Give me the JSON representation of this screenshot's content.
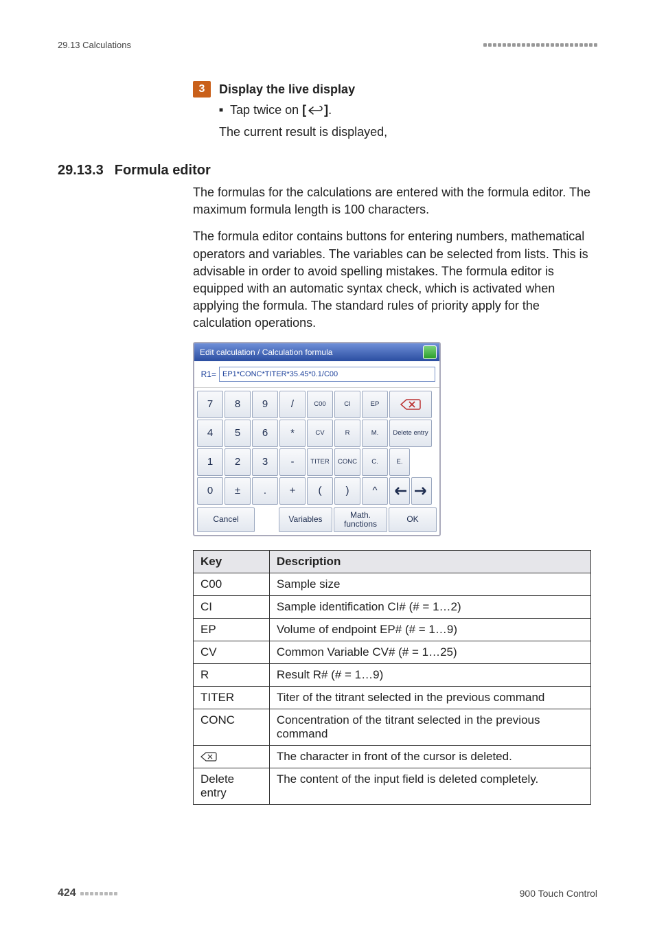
{
  "header": {
    "section_label": "29.13 Calculations"
  },
  "step": {
    "number": "3",
    "title": "Display the live display",
    "bullet": "Tap twice on ",
    "bracket_open": "[",
    "bracket_close": "]",
    "after_icon": ".",
    "result_line": "The current result is displayed,"
  },
  "section": {
    "number": "29.13.3",
    "title": "Formula editor",
    "para1": "The formulas for the calculations are entered with the formula editor. The maximum formula length is 100 characters.",
    "para2": "The formula editor contains buttons for entering numbers, mathematical operators and variables. The variables can be selected from lists. This is advisable in order to avoid spelling mistakes. The formula editor is equipped with an automatic syntax check, which is activated when applying the formula. The standard rules of priority apply for the calculation operations."
  },
  "editor": {
    "titlebar": "Edit calculation / Calculation formula",
    "r1_label": "R1=",
    "formula_value": "EP1*CONC*TITER*35.45*0.1/C00",
    "keys": {
      "k7": "7",
      "k8": "8",
      "k9": "9",
      "div": "/",
      "c00": "C00",
      "ci": "CI",
      "ep": "EP",
      "k4": "4",
      "k5": "5",
      "k6": "6",
      "mul": "*",
      "cv": "CV",
      "r": "R",
      "mdot": "M.",
      "delete_entry": "Delete entry",
      "k1": "1",
      "k2": "2",
      "k3": "3",
      "minus": "-",
      "titer": "TITER",
      "conc": "CONC",
      "cdot": "C.",
      "edot": "E.",
      "k0": "0",
      "pm": "±",
      "dot": ".",
      "plus": "+",
      "lpar": "(",
      "rpar": ")",
      "caret": "^"
    },
    "bottom": {
      "cancel": "Cancel",
      "variables": "Variables",
      "math_functions": "Math. functions",
      "ok": "OK"
    }
  },
  "table": {
    "head_key": "Key",
    "head_desc": "Description",
    "rows": [
      {
        "key": "C00",
        "desc": "Sample size"
      },
      {
        "key": "CI",
        "desc": "Sample identification CI# (# = 1…2)"
      },
      {
        "key": "EP",
        "desc": "Volume of endpoint EP# (# = 1…9)"
      },
      {
        "key": "CV",
        "desc": "Common Variable CV# (# = 1…25)"
      },
      {
        "key": "R",
        "desc": "Result R# (# = 1…9)"
      },
      {
        "key": "TITER",
        "desc": "Titer of the titrant selected in the previous command"
      },
      {
        "key": "CONC",
        "desc": "Concentration of the titrant selected in the previous command"
      },
      {
        "key": "__BACKSPACE__",
        "desc": "The character in front of the cursor is deleted."
      },
      {
        "key": "Delete entry",
        "desc": "The content of the input field is deleted completely."
      }
    ]
  },
  "footer": {
    "page_number": "424",
    "product": "900 Touch Control"
  }
}
